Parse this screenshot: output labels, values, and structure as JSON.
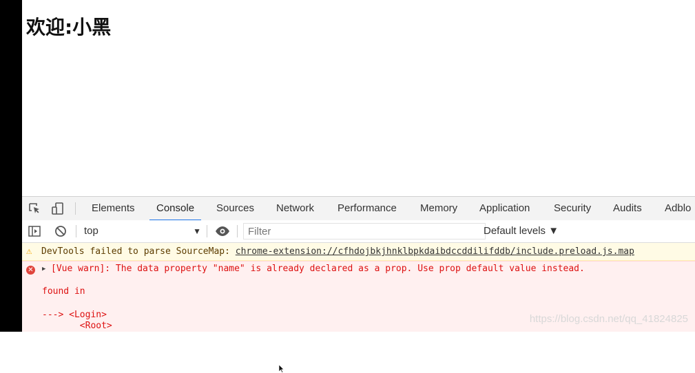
{
  "page": {
    "heading": "欢迎:小黑"
  },
  "devtools": {
    "tabs": [
      "Elements",
      "Console",
      "Sources",
      "Network",
      "Performance",
      "Memory",
      "Application",
      "Security",
      "Audits",
      "Adblo"
    ],
    "active_tab": "Console",
    "toolbar": {
      "context": "top",
      "filter_placeholder": "Filter",
      "levels": "Default levels ▼"
    },
    "console": {
      "warning": {
        "prefix": "DevTools failed to parse SourceMap: ",
        "link": "chrome-extension://cfhdojbkjhnklbpkdaibdccddilifddb/include.preload.js.map"
      },
      "error": {
        "message": "[Vue warn]: The data property \"name\" is already declared as a prop. Use prop default value instead.",
        "found_in": "found in",
        "trace1": "---> <Login>",
        "trace2": "       <Root>"
      }
    },
    "watermark": "https://blog.csdn.net/qq_41824825"
  },
  "icons": {
    "inspect": "inspect-element-icon",
    "device": "device-toolbar-icon",
    "sidebar": "show-sidebar-icon",
    "clear": "clear-console-icon",
    "eye": "live-expression-eye-icon",
    "warning": "warning-triangle-icon",
    "error": "error-circle-icon"
  }
}
